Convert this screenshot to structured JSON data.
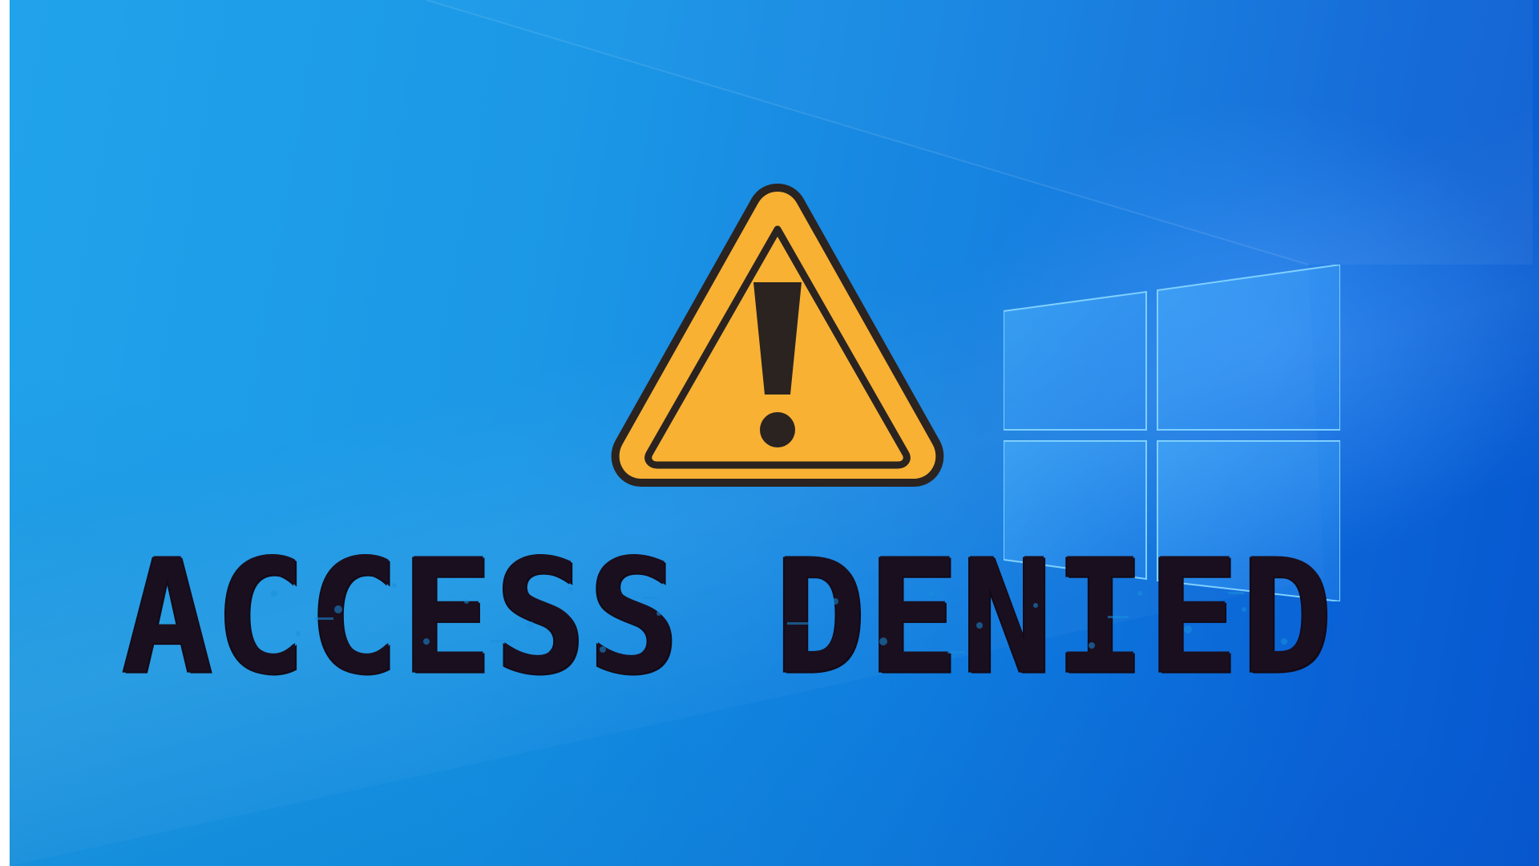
{
  "graphic": {
    "title": "ACCESS DENIED",
    "warning_icon": "warning-triangle-icon",
    "logo_icon": "windows-logo-icon"
  },
  "colors": {
    "background_light": "#1aa0ea",
    "background_dark": "#0757cf",
    "warning_fill": "#f8b133",
    "warning_outline": "#2a2320",
    "title_ink": "#1a0f1f"
  }
}
